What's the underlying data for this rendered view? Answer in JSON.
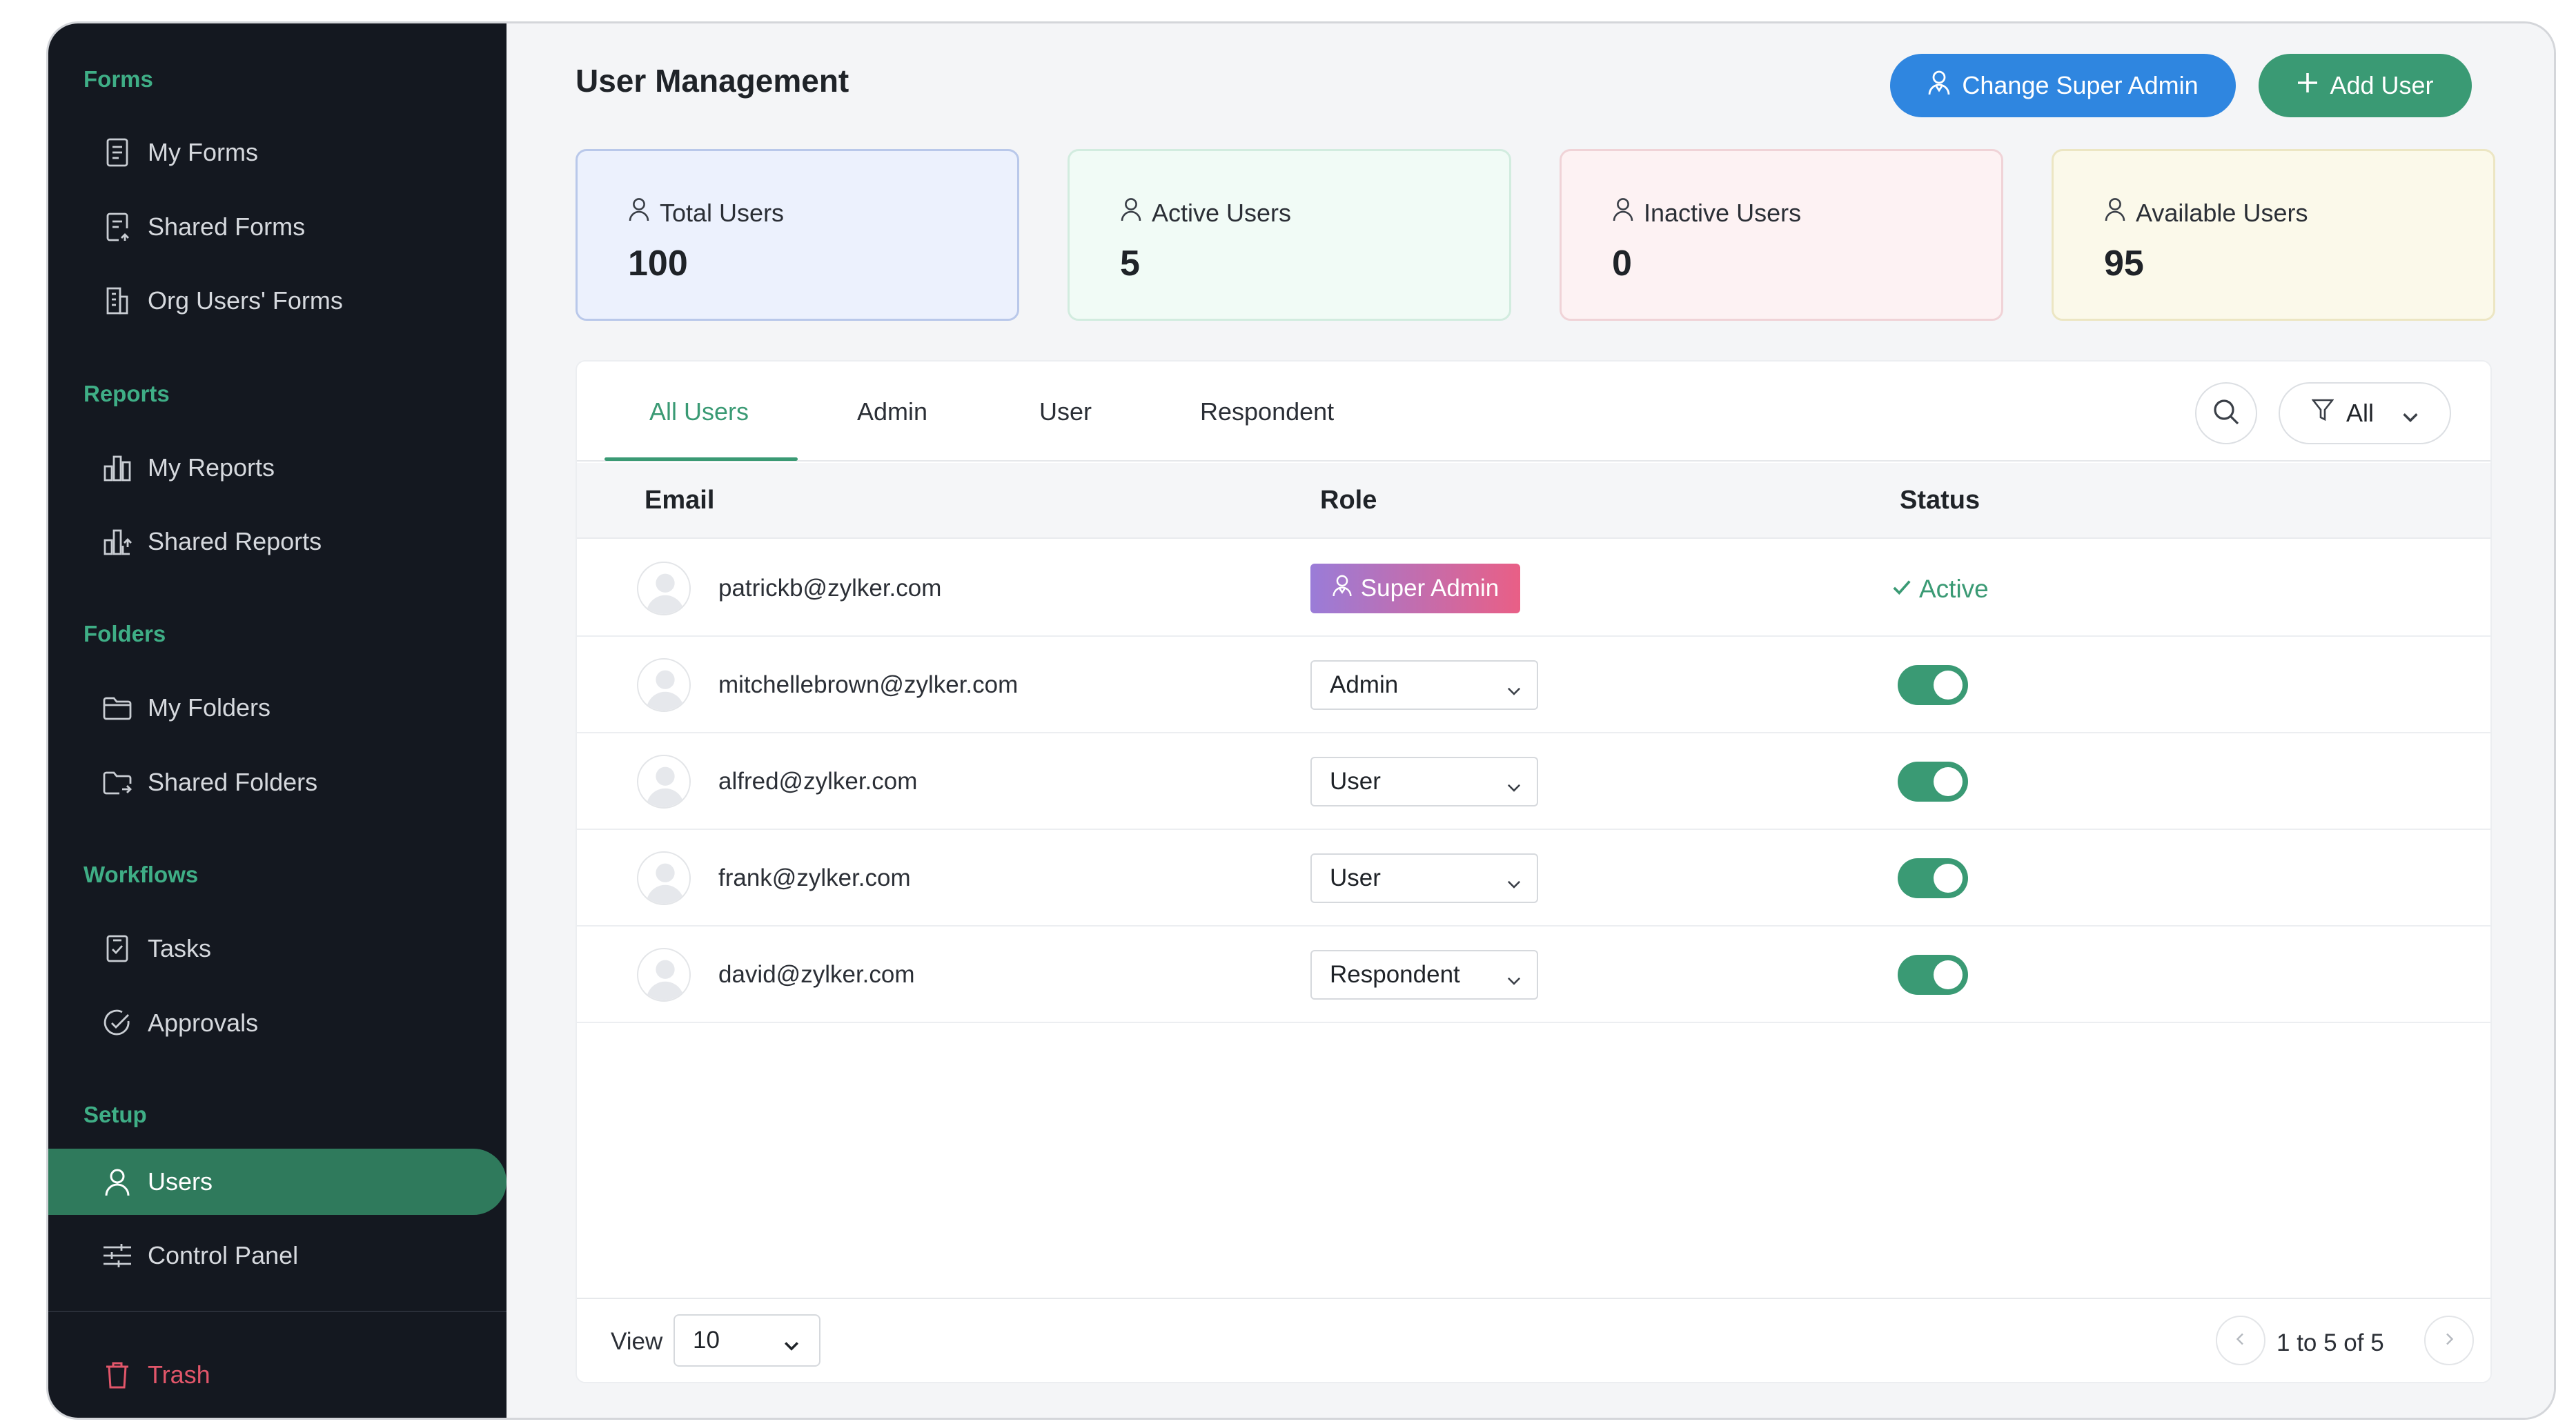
{
  "sidebar": {
    "sections": [
      {
        "title": "Forms",
        "items": [
          {
            "label": "My Forms",
            "icon": "form-icon"
          },
          {
            "label": "Shared Forms",
            "icon": "shared-form-icon"
          },
          {
            "label": "Org Users' Forms",
            "icon": "building-icon"
          }
        ]
      },
      {
        "title": "Reports",
        "items": [
          {
            "label": "My Reports",
            "icon": "report-icon"
          },
          {
            "label": "Shared Reports",
            "icon": "shared-report-icon"
          }
        ]
      },
      {
        "title": "Folders",
        "items": [
          {
            "label": "My Folders",
            "icon": "folder-icon"
          },
          {
            "label": "Shared Folders",
            "icon": "shared-folder-icon"
          }
        ]
      },
      {
        "title": "Workflows",
        "items": [
          {
            "label": "Tasks",
            "icon": "task-icon"
          },
          {
            "label": "Approvals",
            "icon": "approval-icon"
          }
        ]
      },
      {
        "title": "Setup",
        "items": [
          {
            "label": "Users",
            "icon": "user-icon",
            "active": true
          },
          {
            "label": "Control Panel",
            "icon": "sliders-icon"
          }
        ]
      }
    ],
    "trash_label": "Trash"
  },
  "header": {
    "title": "User Management",
    "change_super_admin_label": "Change Super Admin",
    "add_user_label": "Add User"
  },
  "stats": [
    {
      "label": "Total Users",
      "value": "100"
    },
    {
      "label": "Active Users",
      "value": "5"
    },
    {
      "label": "Inactive Users",
      "value": "0"
    },
    {
      "label": "Available Users",
      "value": "95"
    }
  ],
  "tabs": [
    "All Users",
    "Admin",
    "User",
    "Respondent"
  ],
  "active_tab": "All Users",
  "filter": {
    "value": "All"
  },
  "table": {
    "columns": [
      "Email",
      "Role",
      "Status"
    ],
    "rows": [
      {
        "email": "patrickb@zylker.com",
        "role": "Super Admin",
        "status": "Active"
      },
      {
        "email": "mitchellebrown@zylker.com",
        "role": "Admin",
        "status": "enabled"
      },
      {
        "email": "alfred@zylker.com",
        "role": "User",
        "status": "enabled"
      },
      {
        "email": "frank@zylker.com",
        "role": "User",
        "status": "enabled"
      },
      {
        "email": "david@zylker.com",
        "role": "Respondent",
        "status": "enabled"
      }
    ]
  },
  "footer": {
    "view_label": "View",
    "page_size": "10",
    "pagination": "1 to 5 of 5"
  },
  "colors": {
    "sidebar_bg": "#141820",
    "accent_green": "#3a9a74",
    "accent_blue": "#2f86e0",
    "trash_red": "#e2566a"
  }
}
